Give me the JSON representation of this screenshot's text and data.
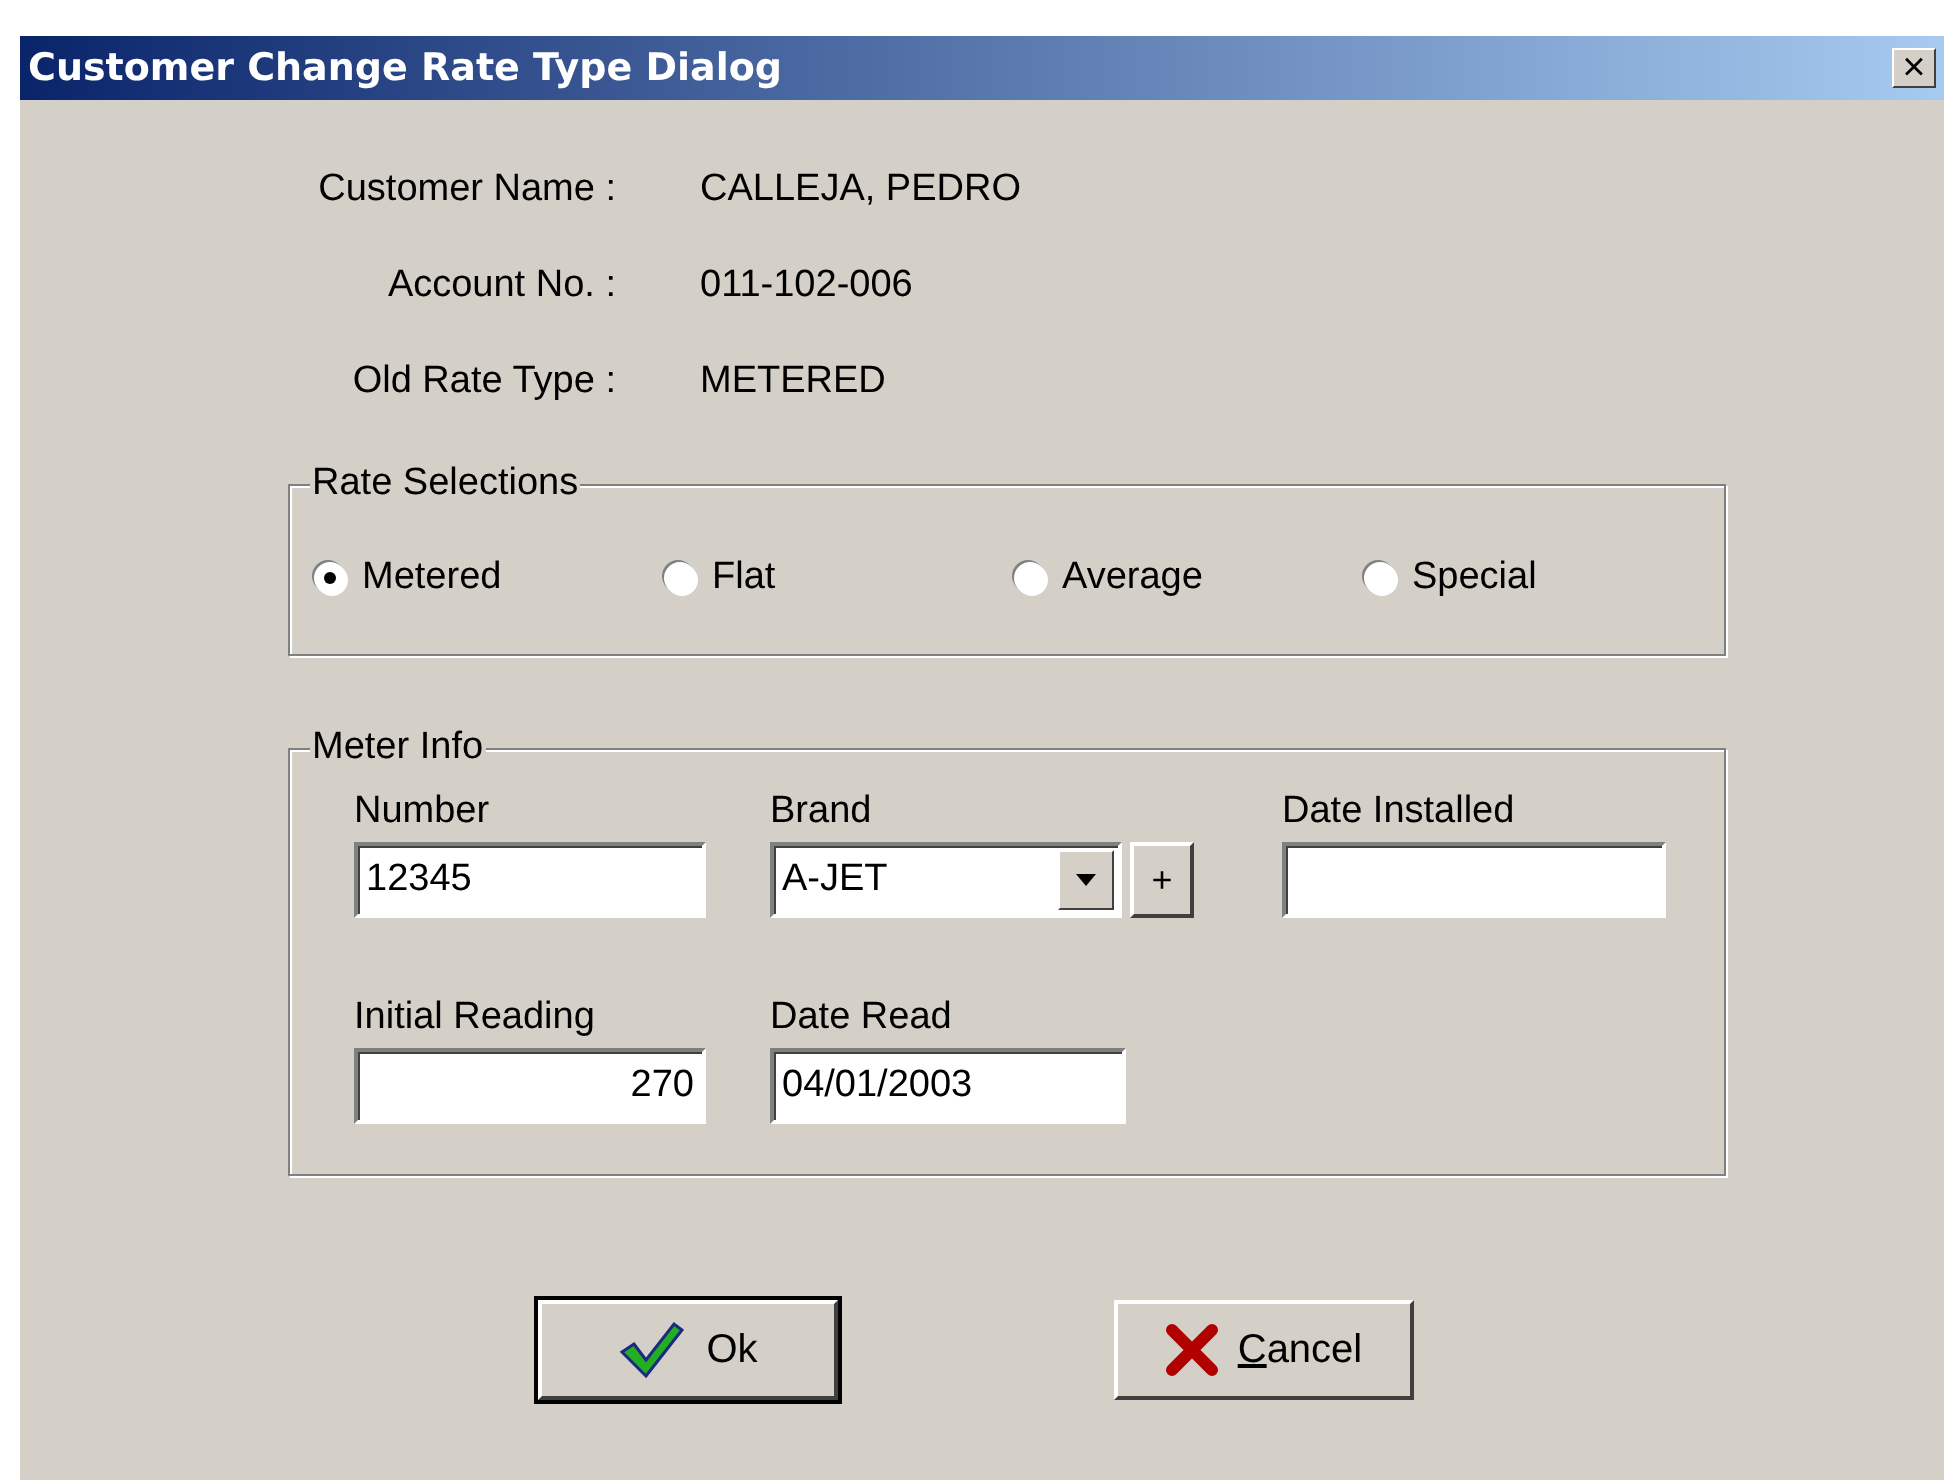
{
  "window": {
    "title": "Customer Change Rate Type Dialog",
    "close_glyph": "×"
  },
  "customer_info": [
    {
      "label": "Customer Name :",
      "value": "CALLEJA, PEDRO"
    },
    {
      "label": "Account No. :",
      "value": "011-102-006"
    },
    {
      "label": "Old Rate Type :",
      "value": "METERED"
    }
  ],
  "rate_selections": {
    "title": "Rate Selections",
    "options": [
      {
        "label": "Metered",
        "selected": true
      },
      {
        "label": "Flat",
        "selected": false
      },
      {
        "label": "Average",
        "selected": false
      },
      {
        "label": "Special",
        "selected": false
      }
    ]
  },
  "meter_info": {
    "title": "Meter Info",
    "number": {
      "label": "Number",
      "value": "12345"
    },
    "brand": {
      "label": "Brand",
      "value": "A-JET",
      "add_button": "+"
    },
    "date_installed": {
      "label": "Date Installed"
    },
    "initial_reading": {
      "label": "Initial Reading",
      "value": "270"
    },
    "date_read": {
      "label": "Date Read",
      "value": "04/01/2003"
    }
  },
  "buttons": [
    {
      "kind": "ok",
      "label": "Ok",
      "default": true
    },
    {
      "kind": "cancel",
      "label": "Cancel",
      "underline_first_letter": true,
      "default": false
    }
  ]
}
